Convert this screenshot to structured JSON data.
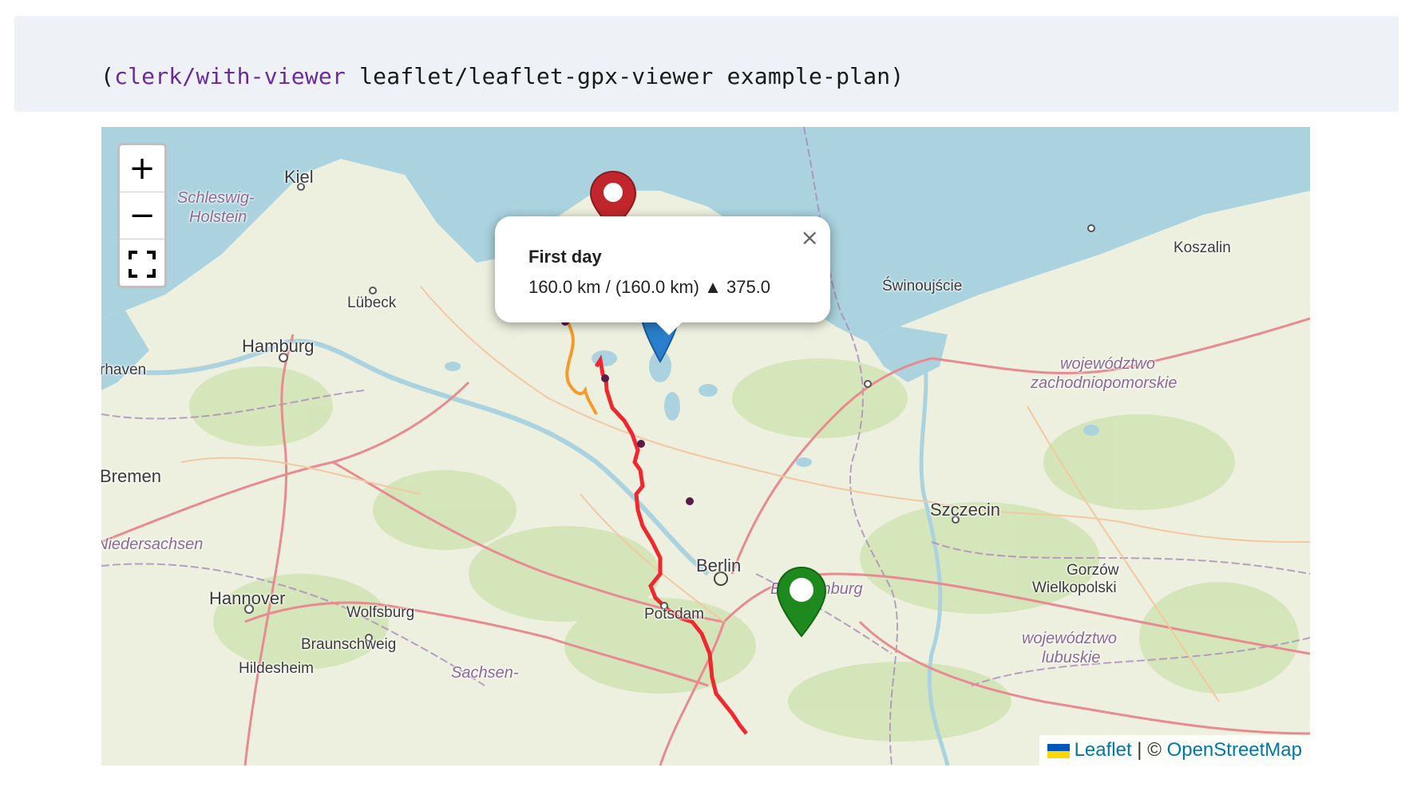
{
  "code": {
    "open_paren": "(",
    "symbol": "clerk/with-viewer",
    "rest": " leaflet/leaflet-gpx-viewer example-plan)"
  },
  "map": {
    "zoom_in_label": "+",
    "zoom_out_label": "−",
    "fullscreen_label": "⛶",
    "places": {
      "kiel": "Kiel",
      "schleswig": "Schleswig-",
      "holstein": "Holstein",
      "lubeck": "Lübeck",
      "hamburg": "Hamburg",
      "bremerhaven": "rhaven",
      "bremen": "Bremen",
      "niedersachsen": "Niedersachsen",
      "hannover": "Hannover",
      "wolfsburg": "Wolfsburg",
      "braunschweig": "Braunschweig",
      "hildesheim": "Hildesheim",
      "sachsen": "Sachsen-",
      "potsdam": "Potsdam",
      "berlin": "Berlin",
      "brandenburg": "Brandenburg",
      "szczecin": "Szczecin",
      "swinoujscie": "Świnoujście",
      "koszalin": "Koszalin",
      "woj_zach_1": "województwo",
      "woj_zach_2": "zachodniopomorskie",
      "gorzow_1": "Gorzów",
      "gorzow_2": "Wielkopolski",
      "woj_lub_1": "województwo",
      "woj_lub_2": "lubuskie"
    },
    "popup": {
      "title": "First day",
      "body": "160.0 km / (160.0 km) ▲ 375.0",
      "close": "×"
    },
    "markers": {
      "start_color": "#2a7ecb",
      "end_color": "#1e8a1e",
      "other_color": "#c0262b"
    },
    "route_colors": {
      "day1": "#f0272e",
      "day0": "#f49b2a"
    },
    "attribution": {
      "leaflet": "Leaflet",
      "separator": " | © ",
      "osm": "OpenStreetMap"
    }
  }
}
